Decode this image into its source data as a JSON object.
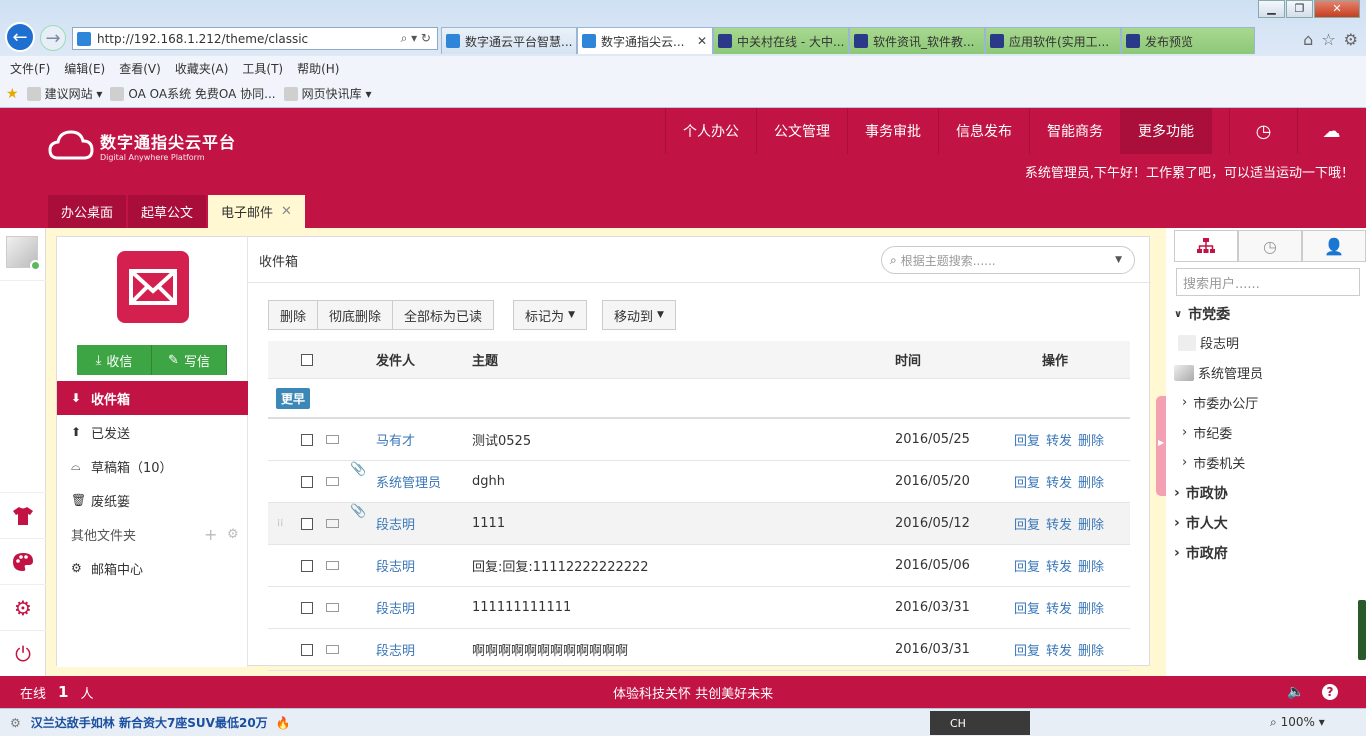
{
  "browser": {
    "url": "http://192.168.1.212/theme/classic",
    "tabs": [
      {
        "label": "数字通云平台智慧...",
        "active": false
      },
      {
        "label": "数字通指尖云...",
        "active": true
      },
      {
        "label": "中关村在线 - 大中...",
        "active": false
      },
      {
        "label": "软件资讯_软件教...",
        "active": false
      },
      {
        "label": "应用软件(实用工...",
        "active": false
      },
      {
        "label": "发布预览",
        "active": false
      }
    ],
    "menu": [
      "文件(F)",
      "编辑(E)",
      "查看(V)",
      "收藏夹(A)",
      "工具(T)",
      "帮助(H)"
    ],
    "favorites": [
      "建议网站 ▾",
      "OA OA系统 免费OA 协同...",
      "网页快讯库 ▾"
    ],
    "status_ad": "汉兰达敌手如林 新合资大7座SUV最低20万",
    "zoom": "100%",
    "ime": "CH"
  },
  "app": {
    "logo_title": "数字通指尖云平台",
    "logo_subtitle": "Digital Anywhere Platform",
    "nav": [
      "个人办公",
      "公文管理",
      "事务审批",
      "信息发布",
      "智能商务",
      "更多功能"
    ],
    "greeting": "系统管理员,下午好！工作累了吧，可以适当运动一下哦！",
    "subtabs": [
      {
        "label": "办公桌面",
        "active": false
      },
      {
        "label": "起草公文",
        "active": false
      },
      {
        "label": "电子邮件",
        "active": true
      }
    ]
  },
  "mail": {
    "receive": "收信",
    "compose": "写信",
    "folders": [
      {
        "label": "收件箱",
        "active": true
      },
      {
        "label": "已发送",
        "active": false
      },
      {
        "label": "草稿箱（10）",
        "active": false
      },
      {
        "label": "废纸篓",
        "active": false
      }
    ],
    "other_folders": "其他文件夹",
    "mailbox_center": "邮箱中心",
    "title": "收件箱",
    "search_placeholder": "根据主题搜索......",
    "toolbar": {
      "delete": "删除",
      "purge": "彻底删除",
      "mark_all_read": "全部标为已读",
      "mark_as": "标记为",
      "move_to": "移动到"
    },
    "columns": {
      "sender": "发件人",
      "subject": "主题",
      "time": "时间",
      "actions": "操作"
    },
    "group_label": "更早",
    "ops": {
      "reply": "回复",
      "forward": "转发",
      "delete": "删除"
    },
    "rows": [
      {
        "sender": "马有才",
        "subject": "测试0525",
        "time": "2016/05/25",
        "attach": false
      },
      {
        "sender": "系统管理员",
        "subject": "dghh",
        "time": "2016/05/20",
        "attach": true
      },
      {
        "sender": "段志明",
        "subject": "1111",
        "time": "2016/05/12",
        "attach": true
      },
      {
        "sender": "段志明",
        "subject": "回复:回复:11112222222222",
        "time": "2016/05/06",
        "attach": false
      },
      {
        "sender": "段志明",
        "subject": "111111111111",
        "time": "2016/03/31",
        "attach": false
      },
      {
        "sender": "段志明",
        "subject": "啊啊啊啊啊啊啊啊啊啊啊啊",
        "time": "2016/03/31",
        "attach": false
      }
    ]
  },
  "contacts": {
    "search_placeholder": "搜索用户......",
    "tree": {
      "root": "市党委",
      "users": [
        "段志明",
        "系统管理员"
      ],
      "subgroups": [
        "市委办公厅",
        "市纪委",
        "市委机关"
      ],
      "groups": [
        "市政协",
        "市人大",
        "市政府"
      ]
    }
  },
  "footer": {
    "online_label": "在线",
    "online_count": "1",
    "online_unit": "人",
    "slogan": "体验科技关怀 共创美好未来"
  },
  "colors": {
    "brand": "#c21444",
    "green": "#3ea544",
    "link": "#3a77b8"
  }
}
